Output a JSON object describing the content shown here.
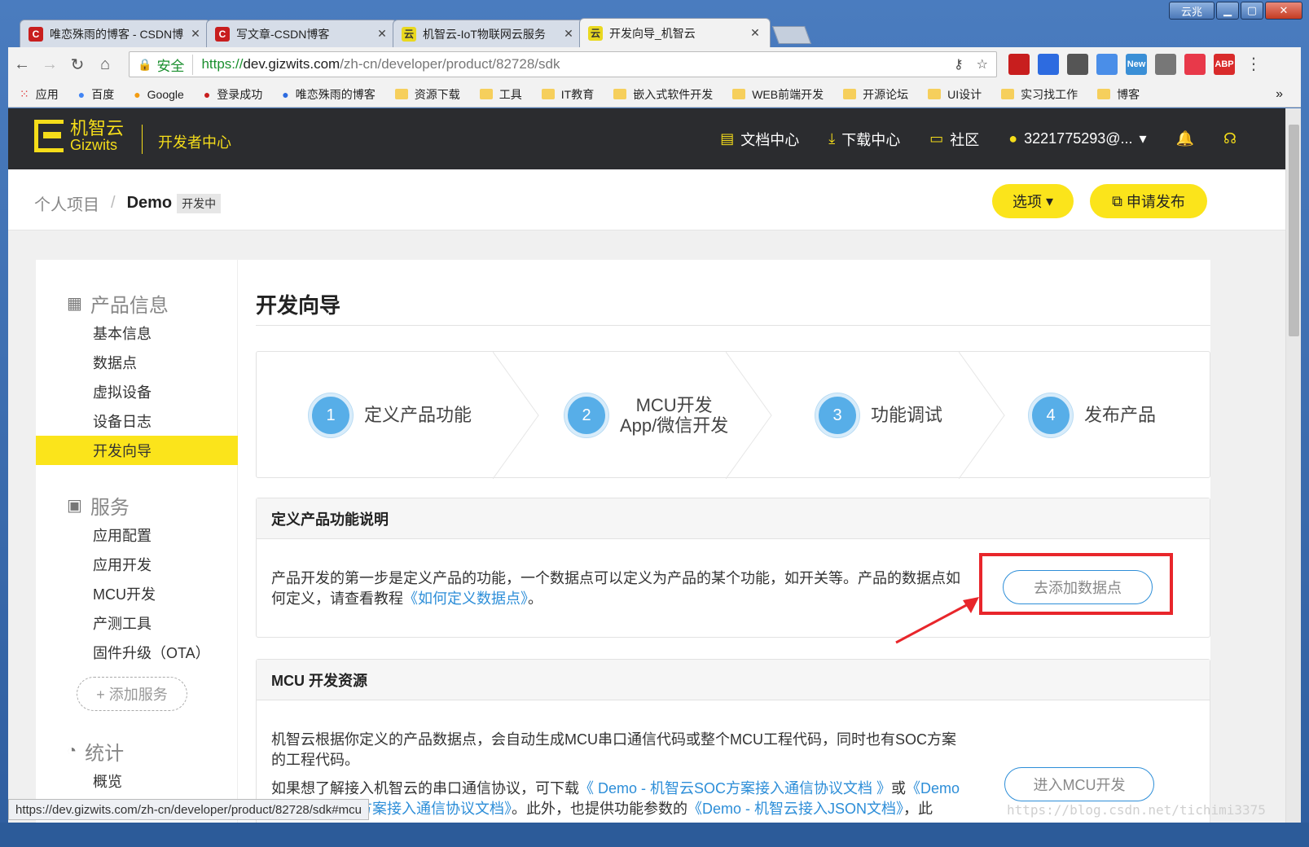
{
  "window": {
    "user_label": "云兆",
    "min_glyph": "▁",
    "max_glyph": "▢",
    "close_glyph": "✕"
  },
  "tabs": [
    {
      "icon": "C",
      "title": "唯恋殊雨的博客 - CSDN博",
      "close": "✕"
    },
    {
      "icon": "C",
      "title": "写文章-CSDN博客",
      "close": "✕"
    },
    {
      "icon": "云",
      "title": "机智云-IoT物联网云服务",
      "close": "✕"
    },
    {
      "icon": "云",
      "title": "开发向导_机智云",
      "close": "✕"
    }
  ],
  "toolbar": {
    "back": "←",
    "forward": "→",
    "reload": "↻",
    "home": "⌂",
    "secure_label": "安全",
    "url_scheme": "https://",
    "url_host": "dev.gizwits.com",
    "url_path": "/zh-cn/developer/product/82728/sdk",
    "key_icon": "⚷",
    "star_icon": "☆",
    "extensions": [
      {
        "label": "",
        "color": "#c81e1e"
      },
      {
        "label": "",
        "color": "#2d6be0"
      },
      {
        "label": "",
        "color": "#555555"
      },
      {
        "label": "",
        "color": "#4a8ee8"
      },
      {
        "label": "New",
        "color": "#3a8fd6"
      },
      {
        "label": "",
        "color": "#777777"
      },
      {
        "label": "",
        "color": "#e8394a"
      },
      {
        "label": "ABP",
        "color": "#d92b2b"
      }
    ],
    "menu": "⋮"
  },
  "bookmarks": {
    "items": [
      {
        "label": "应用",
        "type": "apps"
      },
      {
        "label": "百度",
        "type": "site"
      },
      {
        "label": "Google",
        "type": "site"
      },
      {
        "label": "登录成功",
        "type": "site"
      },
      {
        "label": "唯恋殊雨的博客",
        "type": "site"
      },
      {
        "label": "资源下载",
        "type": "folder"
      },
      {
        "label": "工具",
        "type": "folder"
      },
      {
        "label": "IT教育",
        "type": "folder"
      },
      {
        "label": "嵌入式软件开发",
        "type": "folder"
      },
      {
        "label": "WEB前端开发",
        "type": "folder"
      },
      {
        "label": "开源论坛",
        "type": "folder"
      },
      {
        "label": "UI设计",
        "type": "folder"
      },
      {
        "label": "实习找工作",
        "type": "folder"
      },
      {
        "label": "博客",
        "type": "folder"
      }
    ],
    "more": "»"
  },
  "site": {
    "logo_cn": "机智云",
    "logo_en": "Gizwits",
    "dev_center": "开发者中心",
    "nav": {
      "docs": "文档中心",
      "downloads": "下载中心",
      "community": "社区",
      "account": "3221775293@...",
      "caret": "▾"
    }
  },
  "breadcrumb": {
    "parent": "个人项目",
    "sep": "/",
    "current": "Demo",
    "badge": "开发中",
    "options_btn": "选项",
    "publish_btn": "申请发布"
  },
  "sidebar": {
    "groups": {
      "product": "产品信息",
      "service": "服务",
      "stats": "统计"
    },
    "product_items": [
      "基本信息",
      "数据点",
      "虚拟设备",
      "设备日志",
      "开发向导"
    ],
    "service_items": [
      "应用配置",
      "应用开发",
      "MCU开发",
      "产测工具",
      "固件升级（OTA）"
    ],
    "add_service": "+ 添加服务",
    "stats_items": [
      "概览"
    ]
  },
  "content": {
    "title": "开发向导",
    "steps": [
      {
        "num": "1",
        "line1": "定义产品功能",
        "line2": ""
      },
      {
        "num": "2",
        "line1": "MCU开发",
        "line2": "App/微信开发"
      },
      {
        "num": "3",
        "line1": "功能调试",
        "line2": ""
      },
      {
        "num": "4",
        "line1": "发布产品",
        "line2": ""
      }
    ],
    "define_panel": {
      "heading": "定义产品功能说明",
      "text_before": "产品开发的第一步是定义产品的功能，一个数据点可以定义为产品的某个功能，如开关等。产品的数据点如何定义，请查看教程",
      "link": "《如何定义数据点》",
      "text_after": "。",
      "button": "去添加数据点"
    },
    "mcu_panel": {
      "heading": "MCU 开发资源",
      "para1": "机智云根据你定义的产品数据点，会自动生成MCU串口通信代码或整个MCU工程代码，同时也有SOC方案的工程代码。",
      "para2_before": "如果想了解接入机智云的串口通信协议，可下载",
      "link1": "《 Demo - 机智云SOC方案接入通信协议文档 》",
      "or": "或",
      "link2": "《Demo - 机智云MCU方案接入通信协议文档》",
      "para2_mid": "。此外，也提供功能参数的",
      "link3": "《Demo - 机智云接入JSON文档》",
      "para2_after": "，此",
      "button": "进入MCU开发"
    }
  },
  "status_url": "https://dev.gizwits.com/zh-cn/developer/product/82728/sdk#mcu",
  "watermark": "https://blog.csdn.net/tichimi3375",
  "colors": {
    "brand_yellow": "#fbe41b",
    "header_dark": "#2b2c2f",
    "link_blue": "#2d8ed8",
    "step_blue": "#57aee8",
    "annotation_red": "#e8262b"
  }
}
